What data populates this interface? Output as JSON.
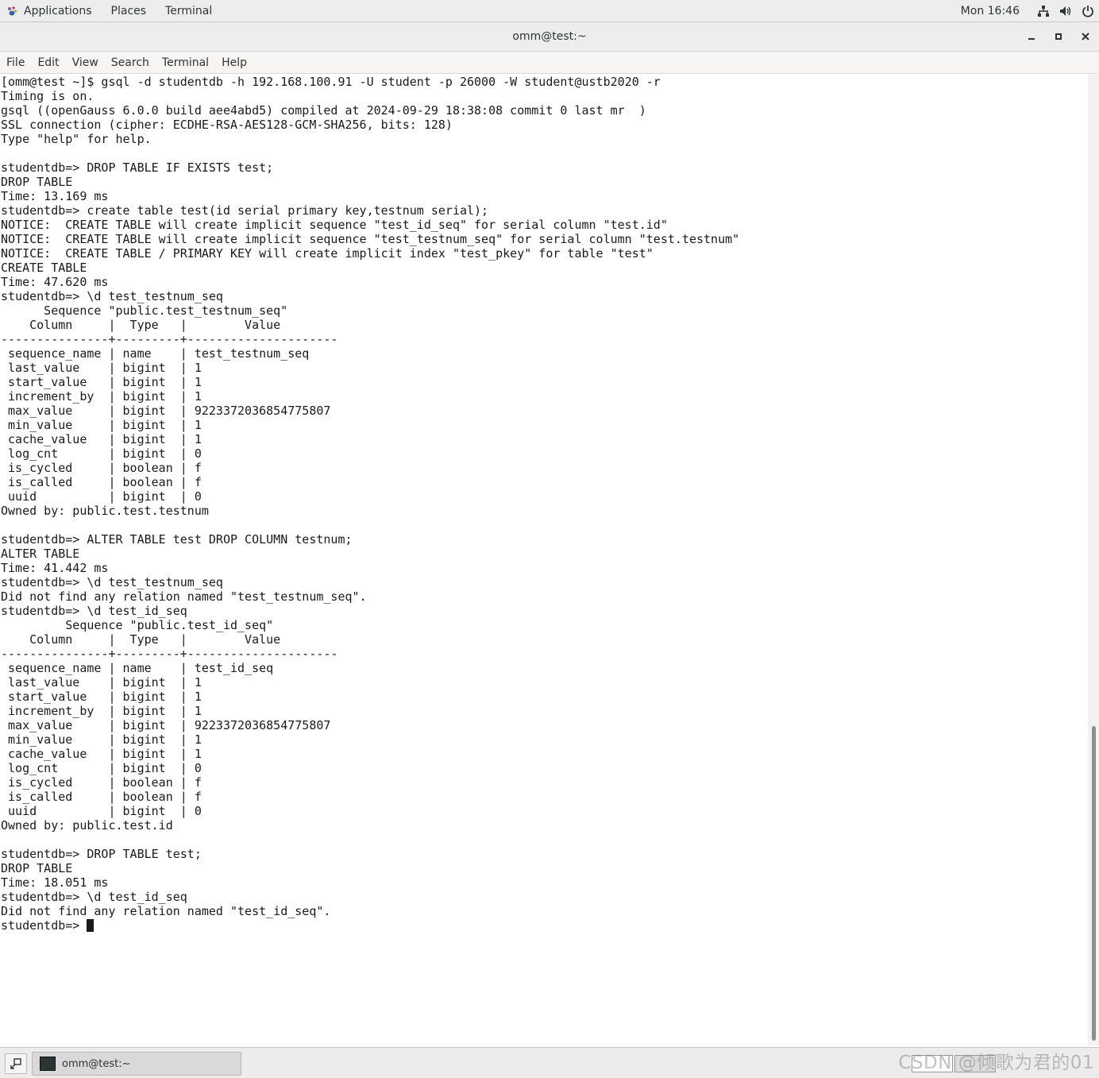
{
  "topbar": {
    "applications": "Applications",
    "places": "Places",
    "terminal": "Terminal",
    "clock": "Mon 16:46"
  },
  "window": {
    "title": "omm@test:~"
  },
  "menubar": {
    "items": [
      "File",
      "Edit",
      "View",
      "Search",
      "Terminal",
      "Help"
    ]
  },
  "terminal": {
    "lines": [
      "[omm@test ~]$ gsql -d studentdb -h 192.168.100.91 -U student -p 26000 -W student@ustb2020 -r",
      "Timing is on.",
      "gsql ((openGauss 6.0.0 build aee4abd5) compiled at 2024-09-29 18:38:08 commit 0 last mr  )",
      "SSL connection (cipher: ECDHE-RSA-AES128-GCM-SHA256, bits: 128)",
      "Type \"help\" for help.",
      "",
      "studentdb=> DROP TABLE IF EXISTS test;",
      "DROP TABLE",
      "Time: 13.169 ms",
      "studentdb=> create table test(id serial primary key,testnum serial);",
      "NOTICE:  CREATE TABLE will create implicit sequence \"test_id_seq\" for serial column \"test.id\"",
      "NOTICE:  CREATE TABLE will create implicit sequence \"test_testnum_seq\" for serial column \"test.testnum\"",
      "NOTICE:  CREATE TABLE / PRIMARY KEY will create implicit index \"test_pkey\" for table \"test\"",
      "CREATE TABLE",
      "Time: 47.620 ms",
      "studentdb=> \\d test_testnum_seq",
      "      Sequence \"public.test_testnum_seq\"",
      "    Column     |  Type   |        Value",
      "---------------+---------+---------------------",
      " sequence_name | name    | test_testnum_seq",
      " last_value    | bigint  | 1",
      " start_value   | bigint  | 1",
      " increment_by  | bigint  | 1",
      " max_value     | bigint  | 9223372036854775807",
      " min_value     | bigint  | 1",
      " cache_value   | bigint  | 1",
      " log_cnt       | bigint  | 0",
      " is_cycled     | boolean | f",
      " is_called     | boolean | f",
      " uuid          | bigint  | 0",
      "Owned by: public.test.testnum",
      "",
      "studentdb=> ALTER TABLE test DROP COLUMN testnum;",
      "ALTER TABLE",
      "Time: 41.442 ms",
      "studentdb=> \\d test_testnum_seq",
      "Did not find any relation named \"test_testnum_seq\".",
      "studentdb=> \\d test_id_seq",
      "         Sequence \"public.test_id_seq\"",
      "    Column     |  Type   |        Value",
      "---------------+---------+---------------------",
      " sequence_name | name    | test_id_seq",
      " last_value    | bigint  | 1",
      " start_value   | bigint  | 1",
      " increment_by  | bigint  | 1",
      " max_value     | bigint  | 9223372036854775807",
      " min_value     | bigint  | 1",
      " cache_value   | bigint  | 1",
      " log_cnt       | bigint  | 0",
      " is_cycled     | boolean | f",
      " is_called     | boolean | f",
      " uuid          | bigint  | 0",
      "Owned by: public.test.id",
      "",
      "studentdb=> DROP TABLE test;",
      "DROP TABLE",
      "Time: 18.051 ms",
      "studentdb=> \\d test_id_seq",
      "Did not find any relation named \"test_id_seq\".",
      "studentdb=> "
    ]
  },
  "taskbar": {
    "task_label": "omm@test:~"
  },
  "watermark": "CSDN @倾歌为君的01",
  "icons": {
    "applications": "gnome-foot-icon",
    "network": "network-icon",
    "volume": "volume-icon",
    "power": "power-icon",
    "minimize": "minimize-icon",
    "maximize": "maximize-icon",
    "close": "close-icon",
    "show_desktop": "show-desktop-icon",
    "terminal_task": "terminal-icon"
  }
}
